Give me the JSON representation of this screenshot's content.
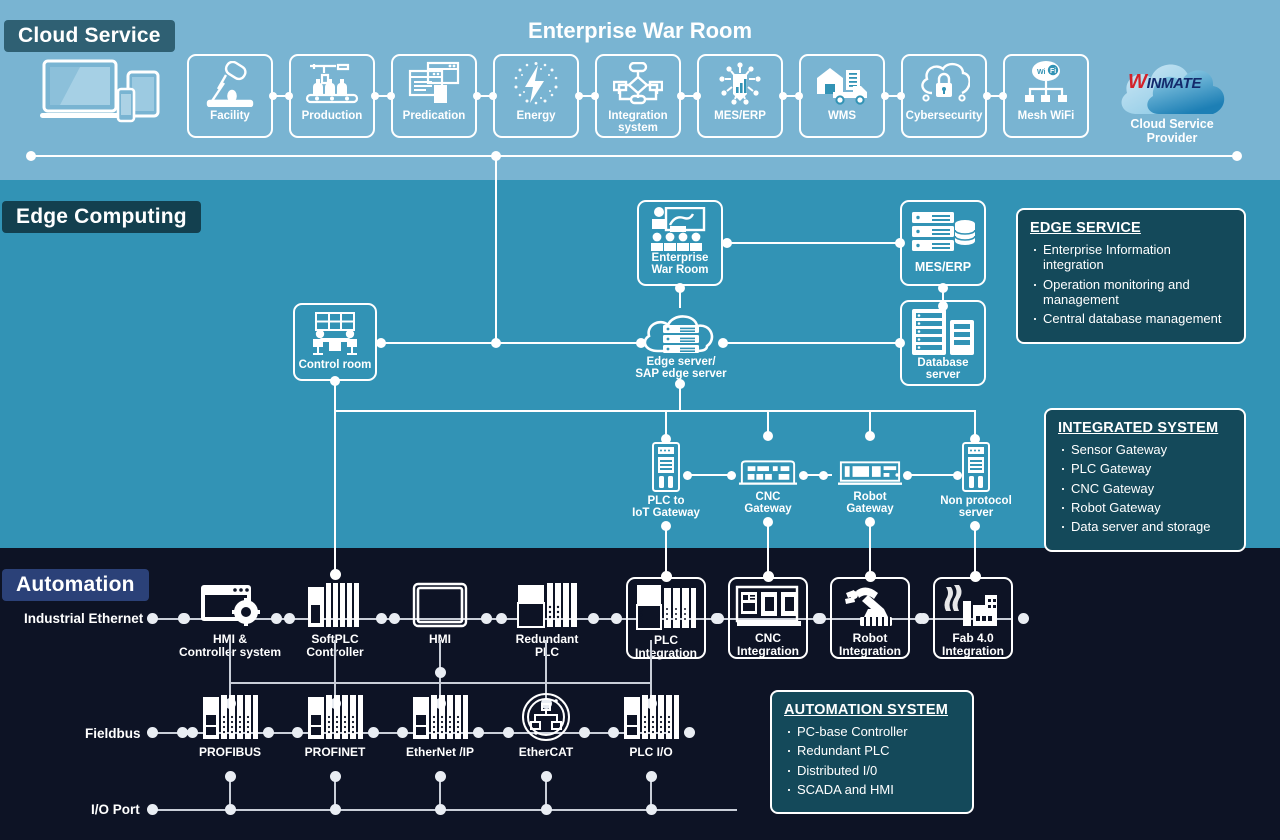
{
  "main_title": "Enterprise War Room",
  "sections": {
    "cloud": {
      "badge": "Cloud Service"
    },
    "edge": {
      "badge": "Edge Computing"
    },
    "automation": {
      "badge": "Automation"
    }
  },
  "cloud_row": {
    "devices_icon": "laptop-and-tablet-icon",
    "items": [
      {
        "label": "Facility",
        "icon": "industrial-machine-icon"
      },
      {
        "label": "Production",
        "icon": "bottling-line-icon"
      },
      {
        "label": "Predication",
        "icon": "analytics-window-icon"
      },
      {
        "label": "Energy",
        "icon": "energy-bolt-icon"
      },
      {
        "label": "Integration\nsystem",
        "icon": "flowchart-icon"
      },
      {
        "label": "MES/ERP",
        "icon": "circuit-chip-icon"
      },
      {
        "label": "WMS",
        "icon": "warehouse-truck-icon"
      },
      {
        "label": "Cybersecurity",
        "icon": "cloud-lock-icon"
      },
      {
        "label": "Mesh WiFi",
        "icon": "mesh-wifi-icon"
      }
    ],
    "provider": {
      "logo_w": "W",
      "logo_rest": "INMATE",
      "label": "Cloud Service\nProvider",
      "icon": "cloud-logo-icon"
    }
  },
  "edge_row": {
    "nodes": [
      {
        "id": "control-room",
        "label": "Control room",
        "icon": "control-room-icon"
      },
      {
        "id": "enterprise-war-room",
        "label": "Enterprise\nWar Room",
        "icon": "presentation-icon"
      },
      {
        "id": "mes-erp",
        "label": "MES/ERP",
        "icon": "server-database-icon"
      },
      {
        "id": "edge-server",
        "label": "Edge server/\nSAP edge server",
        "icon": "cloud-server-icon"
      },
      {
        "id": "database-server",
        "label": "Database\nserver",
        "icon": "database-rack-icon"
      }
    ],
    "gateways": [
      {
        "id": "plc-iot-gateway",
        "label": "PLC to\nIoT Gateway",
        "icon": "din-rail-gateway-icon"
      },
      {
        "id": "cnc-gateway",
        "label": "CNC\nGateway",
        "icon": "gateway-box-icon"
      },
      {
        "id": "robot-gateway",
        "label": "Robot\nGateway",
        "icon": "rack-gateway-icon"
      },
      {
        "id": "non-protocol-server",
        "label": "Non protocol\nserver",
        "icon": "din-rail-gateway-icon"
      }
    ]
  },
  "automation_row": {
    "row_labels": {
      "ethernet": "Industrial Ethernet",
      "fieldbus": "Fieldbus",
      "ioport": "I/O Port"
    },
    "ethernet_items": [
      {
        "label": "HMI &\nController system",
        "icon": "hmi-controller-icon",
        "boxed": false
      },
      {
        "label": "SoftPLC\nController",
        "icon": "plc-rack-icon",
        "boxed": false
      },
      {
        "label": "HMI",
        "icon": "hmi-panel-icon",
        "boxed": false
      },
      {
        "label": "Redundant\nPLC",
        "icon": "redundant-plc-icon",
        "boxed": false
      },
      {
        "label": "PLC\nIntegration",
        "icon": "plc-module-icon",
        "boxed": true
      },
      {
        "label": "CNC\nIntegration",
        "icon": "cnc-machine-icon",
        "boxed": true
      },
      {
        "label": "Robot\nIntegration",
        "icon": "robot-arm-icon",
        "boxed": true
      },
      {
        "label": "Fab 4.0\nIntegration",
        "icon": "factory-icon",
        "boxed": true
      }
    ],
    "fieldbus_items": [
      {
        "label": "PROFIBUS",
        "icon": "io-module-icon"
      },
      {
        "label": "PROFINET",
        "icon": "io-module-icon"
      },
      {
        "label": "EtherNet /IP",
        "icon": "io-module-icon"
      },
      {
        "label": "EtherCAT",
        "icon": "ethercat-ring-icon"
      },
      {
        "label": "PLC I/O",
        "icon": "io-module-icon"
      }
    ]
  },
  "info_boxes": {
    "edge_service": {
      "title": "EDGE SERVICE",
      "items": [
        "Enterprise Information integration",
        "Operation monitoring and management",
        "Central database management"
      ]
    },
    "integrated_system": {
      "title": "INTEGRATED SYSTEM",
      "items": [
        "Sensor Gateway",
        "PLC Gateway",
        "CNC Gateway",
        "Robot Gateway",
        "Data server and storage"
      ]
    },
    "automation_system": {
      "title": "AUTOMATION SYSTEM",
      "items": [
        "PC-base Controller",
        "Redundant PLC",
        "Distributed I/0",
        "SCADA and HMI"
      ]
    }
  },
  "colors": {
    "cloud_band": "#79b4d2",
    "edge_band": "#3293b5",
    "automation_band": "#0d1325",
    "cloud_badge": "#2f6073",
    "edge_badge": "#13404f",
    "automation_badge": "#2b4178",
    "info_panel": "#14495a",
    "line": "#ffffff",
    "automation_line": "#c9ced8"
  }
}
